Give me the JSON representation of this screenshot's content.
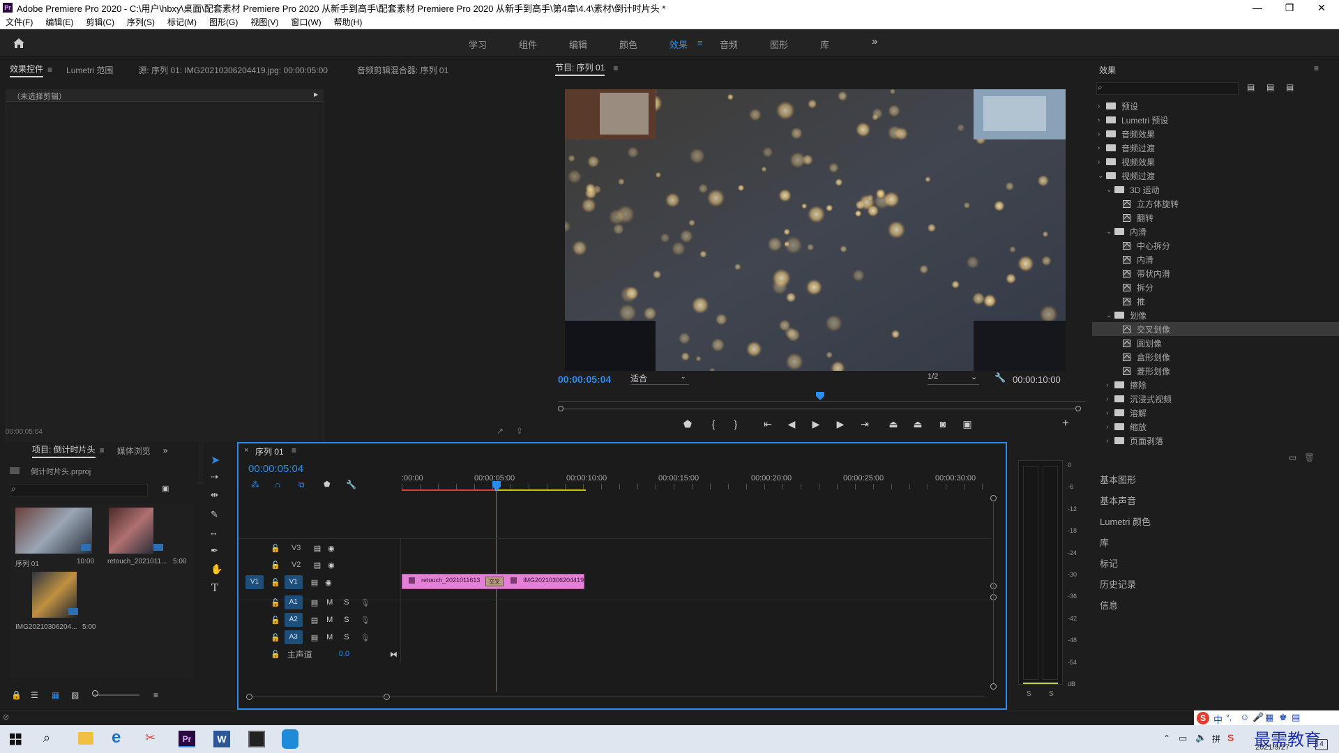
{
  "window": {
    "title": "Adobe Premiere Pro 2020 - C:\\用户\\hbxy\\桌面\\配套素材 Premiere Pro 2020 从新手到高手\\配套素材 Premiere Pro 2020 从新手到高手\\第4章\\4.4\\素材\\倒计时片头 *",
    "logo": "Pr",
    "min": "—",
    "max": "❐",
    "close": "✕"
  },
  "menu": [
    "文件(F)",
    "编辑(E)",
    "剪辑(C)",
    "序列(S)",
    "标记(M)",
    "图形(G)",
    "视图(V)",
    "窗口(W)",
    "帮助(H)"
  ],
  "workspaces": [
    {
      "label": "学习"
    },
    {
      "label": "组件"
    },
    {
      "label": "编辑"
    },
    {
      "label": "颜色"
    },
    {
      "label": "效果",
      "active": true
    },
    {
      "label": "音频"
    },
    {
      "label": "图形"
    },
    {
      "label": "库"
    }
  ],
  "workspace_more": "»",
  "effect_controls": {
    "tabs": [
      "效果控件",
      "Lumetri 范围",
      "源: 序列 01: IMG20210306204419.jpg: 00:00:05:00",
      "音频剪辑混合器: 序列 01"
    ],
    "no_clip": "（未选择剪辑）",
    "timecode": "00:00:05:04"
  },
  "program": {
    "title": "节目: 序列 01",
    "timecode": "00:00:05:04",
    "fit": "适合",
    "resolution": "1/2",
    "duration": "00:00:10:00"
  },
  "effects": {
    "title": "效果",
    "items": [
      {
        "label": "预设",
        "level": 0,
        "kind": "folder",
        "open": false
      },
      {
        "label": "Lumetri 预设",
        "level": 0,
        "kind": "folder",
        "open": false
      },
      {
        "label": "音频效果",
        "level": 0,
        "kind": "folder",
        "open": false
      },
      {
        "label": "音频过渡",
        "level": 0,
        "kind": "folder",
        "open": false
      },
      {
        "label": "视频效果",
        "level": 0,
        "kind": "folder",
        "open": false
      },
      {
        "label": "视频过渡",
        "level": 0,
        "kind": "folder",
        "open": true
      },
      {
        "label": "3D 运动",
        "level": 1,
        "kind": "folder",
        "open": true
      },
      {
        "label": "立方体旋转",
        "level": 2,
        "kind": "fx"
      },
      {
        "label": "翻转",
        "level": 2,
        "kind": "fx"
      },
      {
        "label": "内滑",
        "level": 1,
        "kind": "folder",
        "open": true
      },
      {
        "label": "中心拆分",
        "level": 2,
        "kind": "fx"
      },
      {
        "label": "内滑",
        "level": 2,
        "kind": "fx"
      },
      {
        "label": "带状内滑",
        "level": 2,
        "kind": "fx"
      },
      {
        "label": "拆分",
        "level": 2,
        "kind": "fx"
      },
      {
        "label": "推",
        "level": 2,
        "kind": "fx"
      },
      {
        "label": "划像",
        "level": 1,
        "kind": "folder",
        "open": true
      },
      {
        "label": "交叉划像",
        "level": 2,
        "kind": "fx",
        "selected": true
      },
      {
        "label": "圆划像",
        "level": 2,
        "kind": "fx"
      },
      {
        "label": "盒形划像",
        "level": 2,
        "kind": "fx"
      },
      {
        "label": "菱形划像",
        "level": 2,
        "kind": "fx"
      },
      {
        "label": "擦除",
        "level": 1,
        "kind": "folder",
        "open": false
      },
      {
        "label": "沉浸式视频",
        "level": 1,
        "kind": "folder",
        "open": false
      },
      {
        "label": "溶解",
        "level": 1,
        "kind": "folder",
        "open": false
      },
      {
        "label": "缩放",
        "level": 1,
        "kind": "folder",
        "open": false
      },
      {
        "label": "页面剥落",
        "level": 1,
        "kind": "folder",
        "open": false
      }
    ]
  },
  "side_panels": [
    "基本图形",
    "基本声音",
    "Lumetri 颜色",
    "库",
    "标记",
    "历史记录",
    "信息"
  ],
  "project": {
    "tabs": [
      "项目: 倒计时片头",
      "媒体浏览"
    ],
    "file": "倒计时片头.prproj",
    "items": [
      {
        "name": "序列 01",
        "duration": "10:00"
      },
      {
        "name": "retouch_2021011...",
        "duration": "5:00"
      },
      {
        "name": "IMG20210306204...",
        "duration": "5:00"
      }
    ]
  },
  "timeline": {
    "tab": "序列 01",
    "timecode": "00:00:05:04",
    "ruler": [
      ":00:00",
      "00:00:05:00",
      "00:00:10:00",
      "00:00:15:00",
      "00:00:20:00",
      "00:00:25:00",
      "00:00:30:00"
    ],
    "video_tracks": [
      "V3",
      "V2",
      "V1"
    ],
    "audio_tracks": [
      "A1",
      "A2",
      "A3"
    ],
    "source_patch": "V1",
    "master_label": "主声道",
    "master_value": "0.0",
    "mute": "M",
    "solo": "S",
    "clip1": "retouch_2021011613",
    "clip2": "IMG20210306204419",
    "transition": "交叉"
  },
  "vu_meter": {
    "labels": [
      "0",
      "-6",
      "-12",
      "-18",
      "-24",
      "-30",
      "-36",
      "-42",
      "-48",
      "-54",
      "dB"
    ],
    "solo_left": "S",
    "solo_right": "S"
  },
  "taskbar": {
    "ime": "中",
    "ime_extra": "°,",
    "watermark": "最需教育",
    "date": "2021/9/27",
    "notif": "4"
  }
}
